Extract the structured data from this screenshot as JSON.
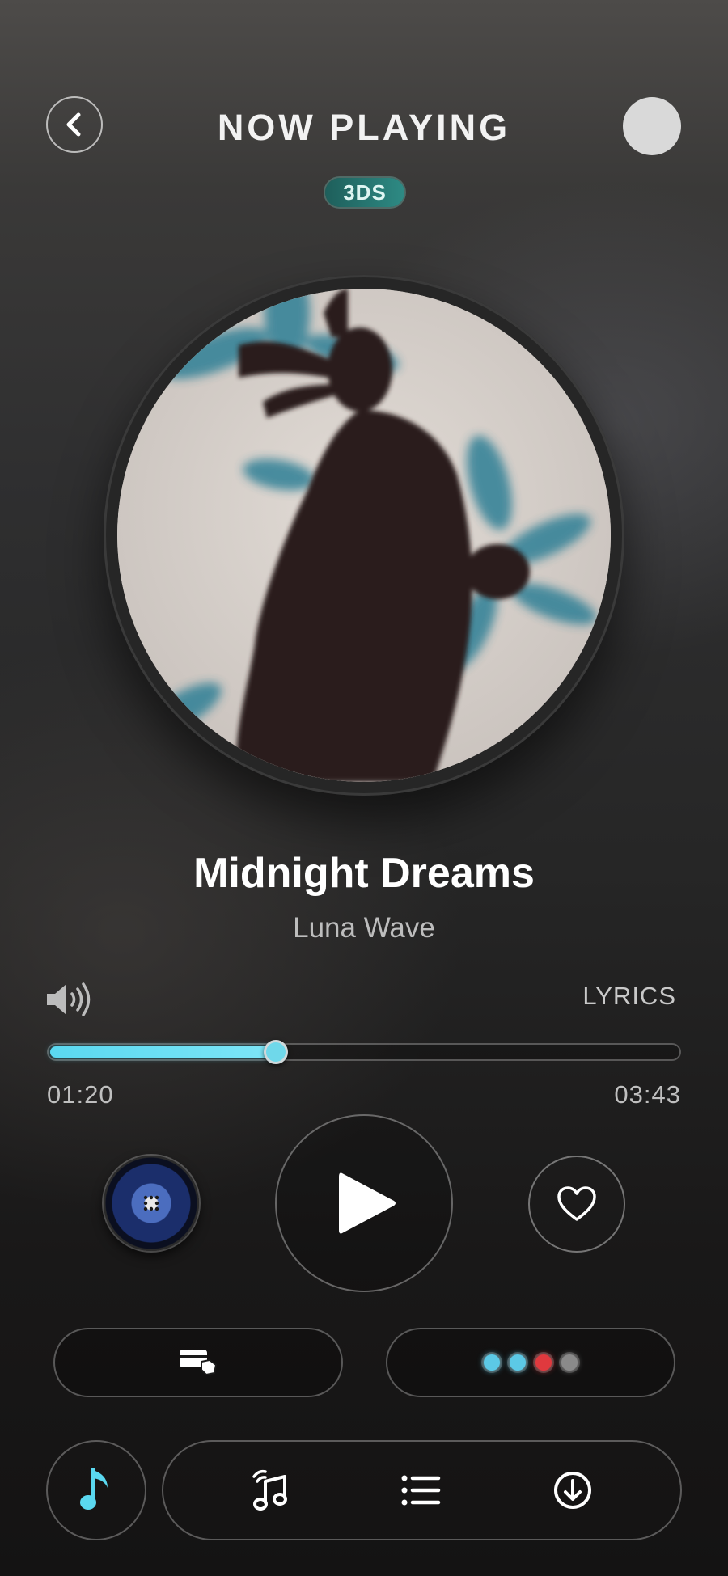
{
  "header": {
    "title": "NOW PLAYING",
    "badge": "3DS",
    "back_icon": "chevron-left-icon"
  },
  "track": {
    "title": "Midnight Dreams",
    "artist": "Luna Wave",
    "elapsed": "01:20",
    "duration": "03:43",
    "progress": 0.359
  },
  "controls": {
    "lyrics_label": "LYRICS",
    "volume_icon": "volume-icon",
    "disc_icon": "vinyl-disc-icon",
    "play_icon": "play-icon",
    "favorite_icon": "heart-icon"
  },
  "panels": {
    "left_icon": "cards-icon",
    "dot_colors": [
      "#5cc9e6",
      "#5cc9e6",
      "#e0393e",
      "#8a8a8a"
    ]
  },
  "nav": {
    "items": [
      "music-note-icon",
      "audio-note-icon",
      "list-icon",
      "download-icon"
    ],
    "accent": "#5ad8f0"
  }
}
